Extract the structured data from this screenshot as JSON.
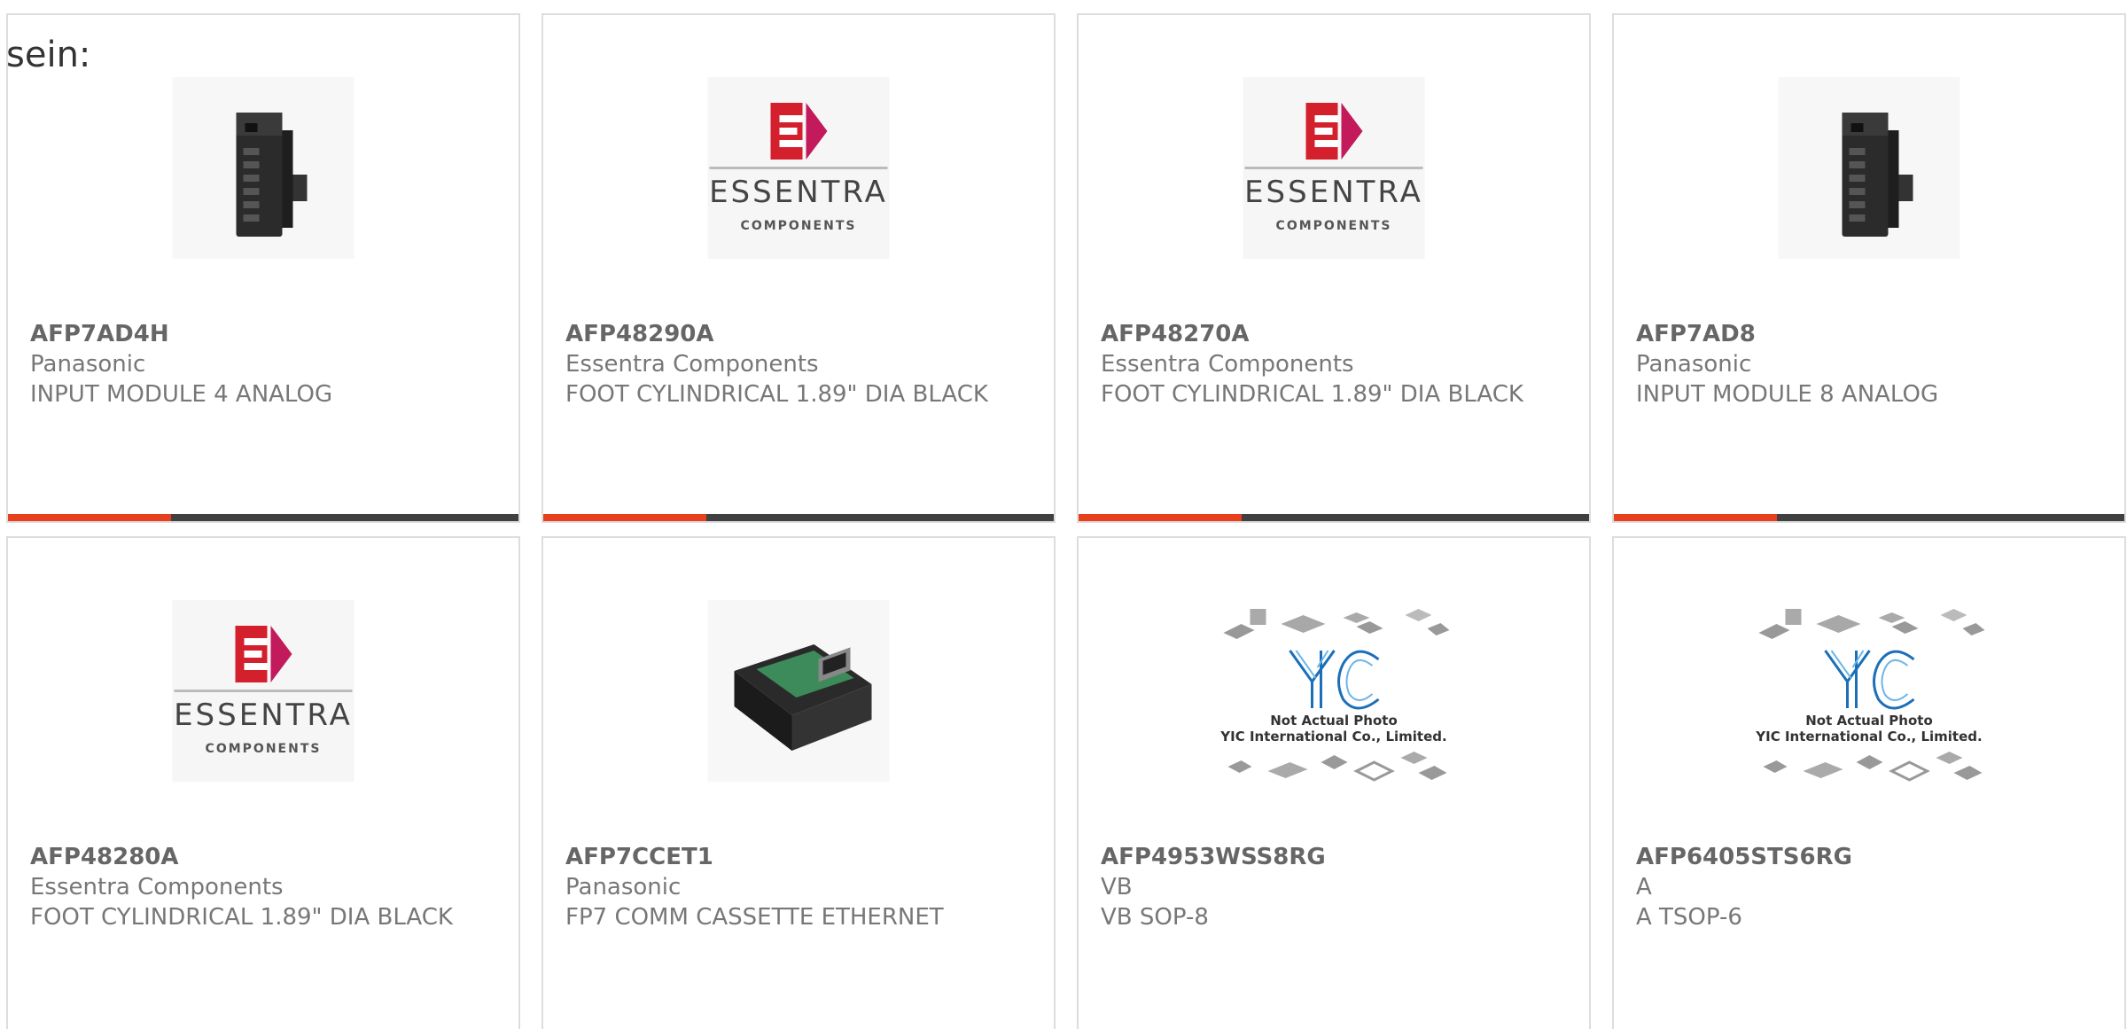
{
  "lead_text": "sein:",
  "products": [
    {
      "part_number": "AFP7AD4H",
      "manufacturer": "Panasonic",
      "description": "INPUT MODULE 4 ANALOG",
      "image": "plc-module-photo"
    },
    {
      "part_number": "AFP48290A",
      "manufacturer": "Essentra Components",
      "description": "FOOT CYLINDRICAL 1.89\" DIA BLACK",
      "image": "essentra-logo"
    },
    {
      "part_number": "AFP48270A",
      "manufacturer": "Essentra Components",
      "description": "FOOT CYLINDRICAL 1.89\" DIA BLACK",
      "image": "essentra-logo"
    },
    {
      "part_number": "AFP7AD8",
      "manufacturer": "Panasonic",
      "description": "INPUT MODULE 8 ANALOG",
      "image": "plc-module-photo"
    },
    {
      "part_number": "AFP48280A",
      "manufacturer": "Essentra Components",
      "description": "FOOT CYLINDRICAL 1.89\" DIA BLACK",
      "image": "essentra-logo"
    },
    {
      "part_number": "AFP7CCET1",
      "manufacturer": "Panasonic",
      "description": "FP7 COMM CASSETTE ETHERNET",
      "image": "ethernet-cassette-photo"
    },
    {
      "part_number": "AFP4953WSS8RG",
      "manufacturer": "VB",
      "description": "VB SOP-8",
      "image": "yic-placeholder"
    },
    {
      "part_number": "AFP6405STS6RG",
      "manufacturer": "A",
      "description": "A TSOP-6",
      "image": "yic-placeholder"
    }
  ],
  "essentra_logo": {
    "word": "ESSENTRA",
    "sub": "COMPONENTS"
  },
  "yic_placeholder": {
    "line1": "Not Actual Photo",
    "line2": "YIC International Co., Limited."
  },
  "colors": {
    "accent": "#e8401c",
    "bar": "#404040",
    "essentra_red": "#d4202c"
  }
}
